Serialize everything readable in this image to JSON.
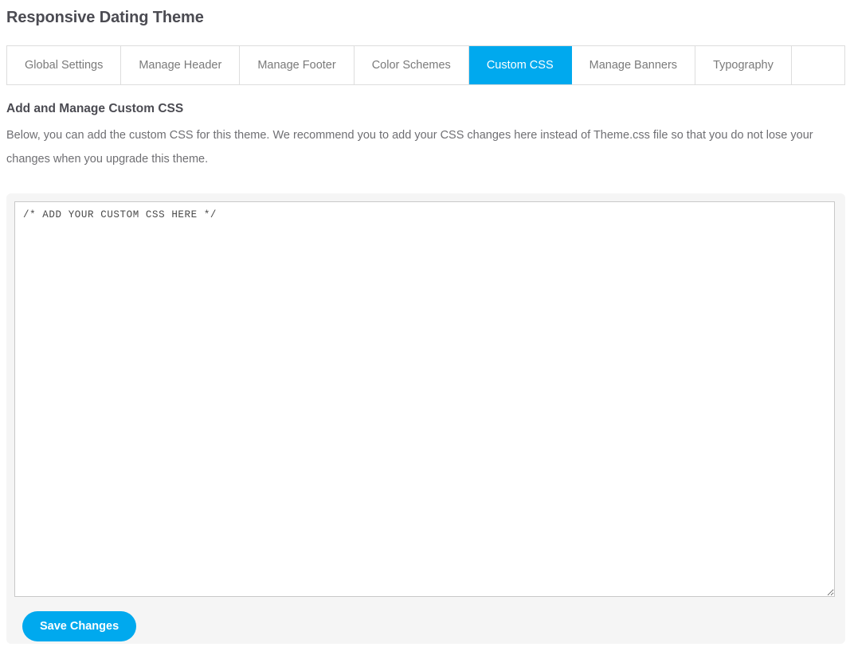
{
  "page": {
    "title": "Responsive Dating Theme"
  },
  "tabs": {
    "items": [
      {
        "label": "Global Settings",
        "active": false
      },
      {
        "label": "Manage Header",
        "active": false
      },
      {
        "label": "Manage Footer",
        "active": false
      },
      {
        "label": "Color Schemes",
        "active": false
      },
      {
        "label": "Custom CSS",
        "active": true
      },
      {
        "label": "Manage Banners",
        "active": false
      },
      {
        "label": "Typography",
        "active": false
      }
    ]
  },
  "section": {
    "heading": "Add and Manage Custom CSS",
    "description": "Below, you can add the custom CSS for this theme. We recommend you to add your CSS changes here instead of Theme.css file so that you do not lose your changes when you upgrade this theme."
  },
  "editor": {
    "value": "",
    "placeholder": "/* ADD YOUR CUSTOM CSS HERE */",
    "resize_handle": "resize-grip"
  },
  "actions": {
    "save_label": "Save Changes"
  },
  "colors": {
    "accent": "#00a9ee",
    "heading": "#4b4b52",
    "body_text": "#6f6f73",
    "tab_text": "#7a7a7a",
    "panel_bg": "#f5f5f5",
    "border": "#dddddd"
  }
}
